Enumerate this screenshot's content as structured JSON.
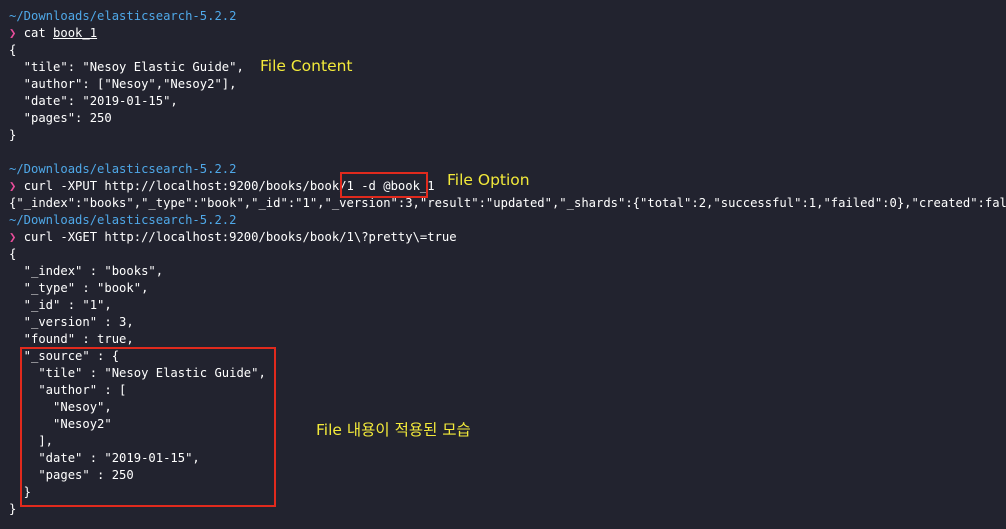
{
  "session1": {
    "path": "~/Downloads/elasticsearch-5.2.2",
    "prompt": "❯",
    "cmd": "cat",
    "arg": "book_1",
    "output": [
      "{",
      "  \"tile\": \"Nesoy Elastic Guide\",",
      "  \"author\": [\"Nesoy\",\"Nesoy2\"],",
      "  \"date\": \"2019-01-15\",",
      "  \"pages\": 250",
      "}"
    ]
  },
  "session2": {
    "path": "~/Downloads/elasticsearch-5.2.2",
    "prompt": "❯",
    "cmd": "curl -XPUT http://localhost:9200/books/book/1 ",
    "option": "-d @book_1",
    "output": "{\"_index\":\"books\",\"_type\":\"book\",\"_id\":\"1\",\"_version\":3,\"result\":\"updated\",\"_shards\":{\"total\":2,\"successful\":1,\"failed\":0},\"created\":false}"
  },
  "session3": {
    "path": "~/Downloads/elasticsearch-5.2.2",
    "prompt": "❯",
    "cmd": "curl -XGET http://localhost:9200/books/book/1\\?pretty\\=true",
    "output": [
      "{",
      "  \"_index\" : \"books\",",
      "  \"_type\" : \"book\",",
      "  \"_id\" : \"1\",",
      "  \"_version\" : 3,",
      "  \"found\" : true,",
      "  \"_source\" : {",
      "    \"tile\" : \"Nesoy Elastic Guide\",",
      "    \"author\" : [",
      "      \"Nesoy\",",
      "      \"Nesoy2\"",
      "    ],",
      "    \"date\" : \"2019-01-15\",",
      "    \"pages\" : 250",
      "  }",
      "}"
    ]
  },
  "annotations": {
    "file_content": "File Content",
    "file_option": "File Option",
    "file_applied": "File 내용이 적용된 모습"
  },
  "colors": {
    "background": "#22232f",
    "path": "#4fa8e8",
    "prompt": "#e94d9b",
    "annotation": "#f3ea3a",
    "highlight_box": "#e12a1d"
  }
}
